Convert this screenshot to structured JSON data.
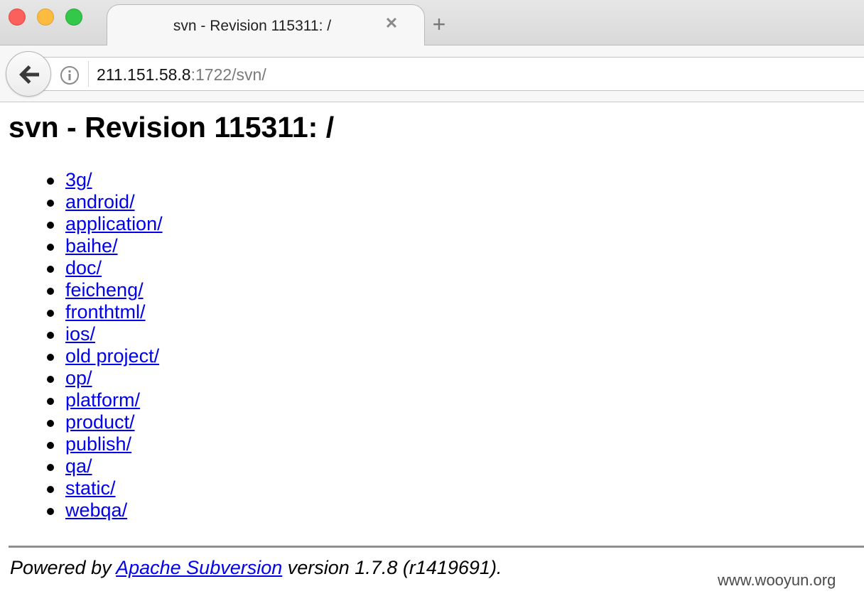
{
  "window": {
    "tab_title": "svn - Revision 115311: /",
    "tab_close_glyph": "✕",
    "new_tab_glyph": "+"
  },
  "toolbar": {
    "url_host": "211.151.58.8",
    "url_rest": ":1722/svn/"
  },
  "page": {
    "title": "svn - Revision 115311: /",
    "directories": [
      "3g/",
      "android/",
      "application/",
      "baihe/",
      "doc/",
      "feicheng/",
      "fronthtml/",
      "ios/",
      "old project/",
      "op/",
      "platform/",
      "product/",
      "publish/",
      "qa/",
      "static/",
      "webqa/"
    ],
    "footer": {
      "prefix": "Powered by ",
      "link_text": "Apache Subversion",
      "suffix": " version 1.7.8 (r1419691)."
    }
  },
  "watermark": "www.wooyun.org",
  "colors": {
    "link": "#0000ee",
    "close_red": "#fc605c",
    "minimize_yellow": "#fdbc40",
    "zoom_green": "#34c84a"
  }
}
